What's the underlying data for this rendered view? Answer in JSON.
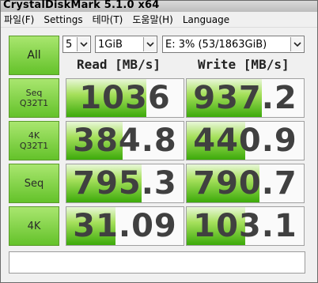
{
  "window": {
    "title": "CrystalDiskMark 5.1.0 x64"
  },
  "menu": [
    {
      "label": "파일(F)"
    },
    {
      "label": "Settings"
    },
    {
      "label": "테마(T)"
    },
    {
      "label": "도움말(H)"
    },
    {
      "label": "Language"
    }
  ],
  "controls": {
    "all_label": "All",
    "count": "5",
    "size": "1GiB",
    "drive": "E: 3% (53/1863GiB)"
  },
  "headers": {
    "read": "Read [MB/s]",
    "write": "Write [MB/s]"
  },
  "rows": [
    {
      "label1": "Seq",
      "label2": "Q32T1",
      "read": "1036",
      "write": "937.2",
      "read_fill": 0.68,
      "write_fill": 0.64
    },
    {
      "label1": "4K",
      "label2": "Q32T1",
      "read": "384.8",
      "write": "440.9",
      "read_fill": 0.48,
      "write_fill": 0.5
    },
    {
      "label1": "Seq",
      "label2": "",
      "read": "795.3",
      "write": "790.7",
      "read_fill": 0.64,
      "write_fill": 0.62
    },
    {
      "label1": "4K",
      "label2": "",
      "read": "31.09",
      "write": "103.1",
      "read_fill": 0.42,
      "write_fill": 0.5
    }
  ],
  "comment": ""
}
